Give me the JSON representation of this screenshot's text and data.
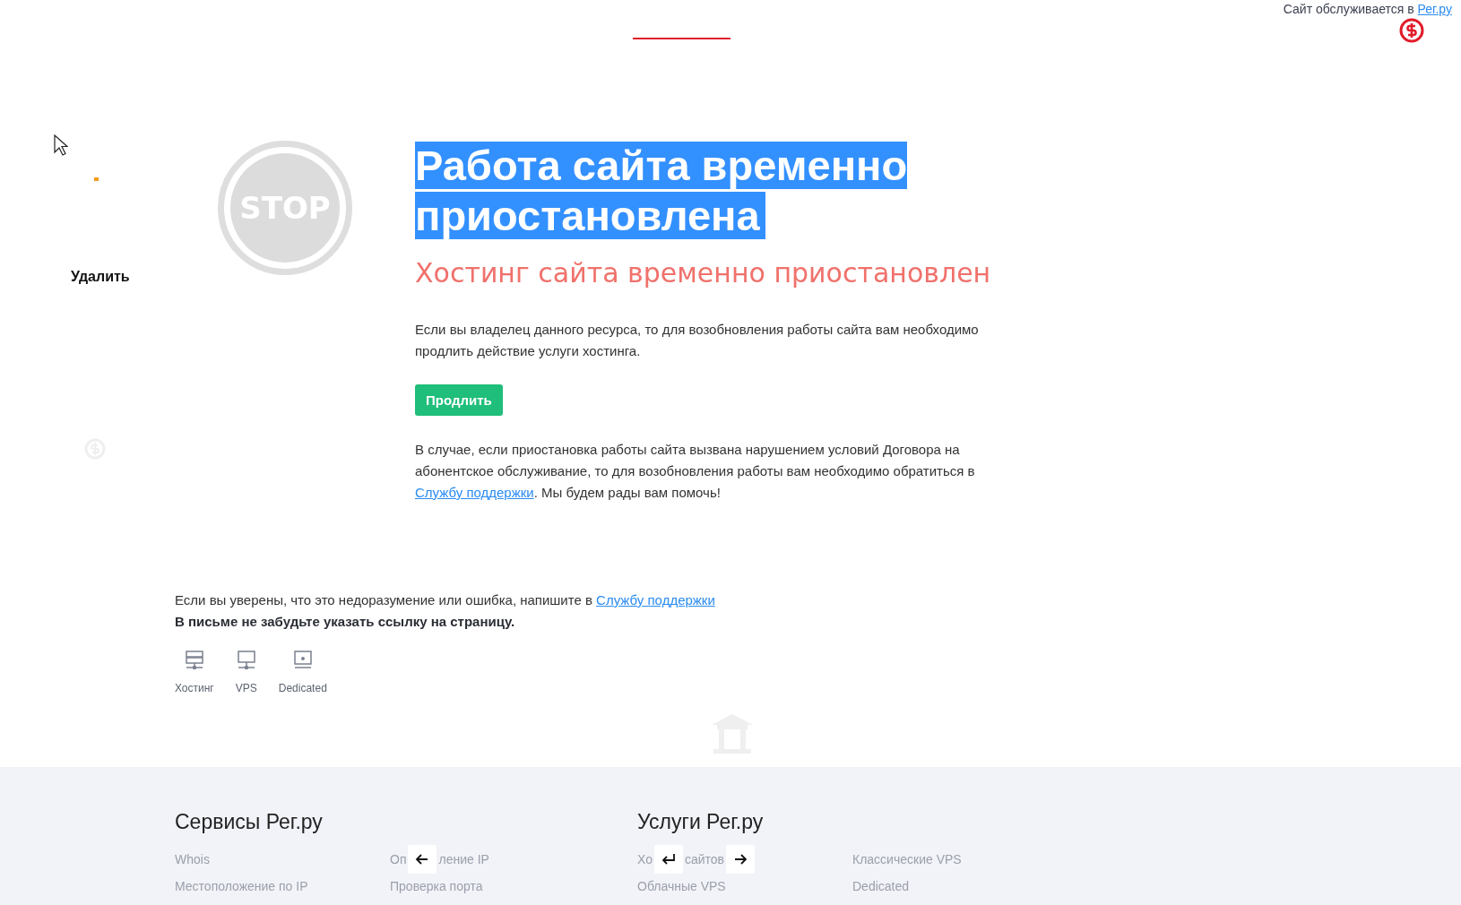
{
  "top_bar": {
    "text": "Сайт обслуживается в",
    "link": "Рег.ру"
  },
  "headline": {
    "text": "Работа сайта временно приостановлена",
    "selected": true
  },
  "stop_sign": {
    "text": "STOP"
  },
  "subheadline": "Хостинг сайта временно приостановлен",
  "paragraph_1": "Если вы владелец данного ресурса, то для возобновления работы сайта вам необходимо продлить действие услуги хостинга.",
  "renew_button": "Продлить",
  "paragraph_2": {
    "before": "В случае, если приостановка работы сайта вызвана нарушением условий Договора на абонентское обслуживание, то для возобновления работы вам необходимо обратиться в",
    "link": "Службу поддержки",
    "after": ". Мы будем рады вам помочь!"
  },
  "notice": {
    "before": "Если вы уверены, что это недоразумение или ошибка, напишите в",
    "link": "Службу поддержки",
    "bold": "В письме не забудьте указать ссылку на страницу."
  },
  "products": [
    {
      "kind": "hosting",
      "label": "Хостинг"
    },
    {
      "kind": "vps",
      "label": "VPS"
    },
    {
      "kind": "dedicated",
      "label": "Dedicated"
    }
  ],
  "footer": {
    "columns": [
      {
        "heading": "Сервисы Рег.ру",
        "items": [
          {
            "segments": [
              {
                "kind": "text",
                "text": "Whois"
              }
            ]
          },
          {
            "segments": [
              {
                "kind": "text",
                "text": "Местоположение по IP"
              }
            ]
          }
        ]
      },
      {
        "items": [
          {
            "segments": [
              {
                "kind": "text",
                "text": "Оп"
              },
              {
                "kind": "left_key"
              },
              {
                "kind": "text",
                "text": "ление IP"
              }
            ]
          },
          {
            "segments": [
              {
                "kind": "text",
                "text": "Проверка порта"
              }
            ]
          }
        ]
      },
      {
        "heading": "Услуги Рег.ру",
        "items": [
          {
            "segments": [
              {
                "kind": "text",
                "text": "Хо"
              },
              {
                "kind": "enter_key"
              },
              {
                "kind": "text",
                "text": "сайтов"
              },
              {
                "kind": "right_key"
              }
            ]
          },
          {
            "segments": [
              {
                "kind": "text",
                "text": "Облачные VPS"
              }
            ]
          }
        ]
      },
      {
        "items": [
          {
            "segments": [
              {
                "kind": "text",
                "text": "Классические VPS"
              }
            ]
          },
          {
            "segments": [
              {
                "kind": "text",
                "text": "Dedicated"
              }
            ]
          }
        ]
      }
    ]
  },
  "game_overlay": {
    "delete_label": "Удалить"
  }
}
